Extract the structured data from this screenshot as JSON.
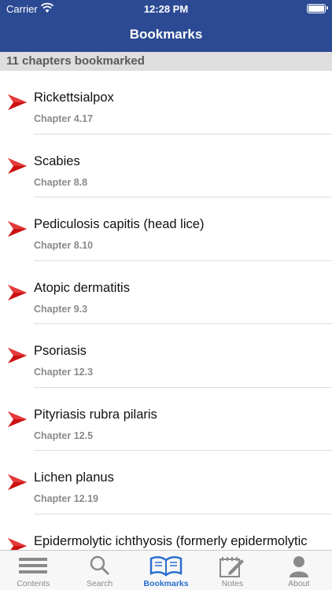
{
  "status_bar": {
    "carrier": "Carrier",
    "time": "12:28 PM"
  },
  "nav": {
    "title": "Bookmarks"
  },
  "section": {
    "header": "11 chapters bookmarked"
  },
  "bookmarks": [
    {
      "title": "Rickettsialpox",
      "chapter": "Chapter 4.17"
    },
    {
      "title": "Scabies",
      "chapter": "Chapter 8.8"
    },
    {
      "title": "Pediculosis capitis (head lice)",
      "chapter": "Chapter 8.10"
    },
    {
      "title": "Atopic dermatitis",
      "chapter": "Chapter 9.3"
    },
    {
      "title": "Psoriasis",
      "chapter": "Chapter 12.3"
    },
    {
      "title": "Pityriasis rubra pilaris",
      "chapter": "Chapter 12.5"
    },
    {
      "title": "Lichen planus",
      "chapter": "Chapter 12.19"
    },
    {
      "title": "Epidermolytic ichthyosis (formerly epidermolytic hyperkeratosis)",
      "chapter": ""
    }
  ],
  "tabs": [
    {
      "label": "Contents",
      "icon": "list-icon",
      "active": false
    },
    {
      "label": "Search",
      "icon": "search-icon",
      "active": false
    },
    {
      "label": "Bookmarks",
      "icon": "open-book-icon",
      "active": true
    },
    {
      "label": "Notes",
      "icon": "notepad-icon",
      "active": false
    },
    {
      "label": "About",
      "icon": "person-icon",
      "active": false
    }
  ],
  "colors": {
    "accent": "#2c4a93",
    "arrow": "#cc1111",
    "active_tab": "#2a6fd1",
    "inactive_tab": "#8a8a8a"
  }
}
